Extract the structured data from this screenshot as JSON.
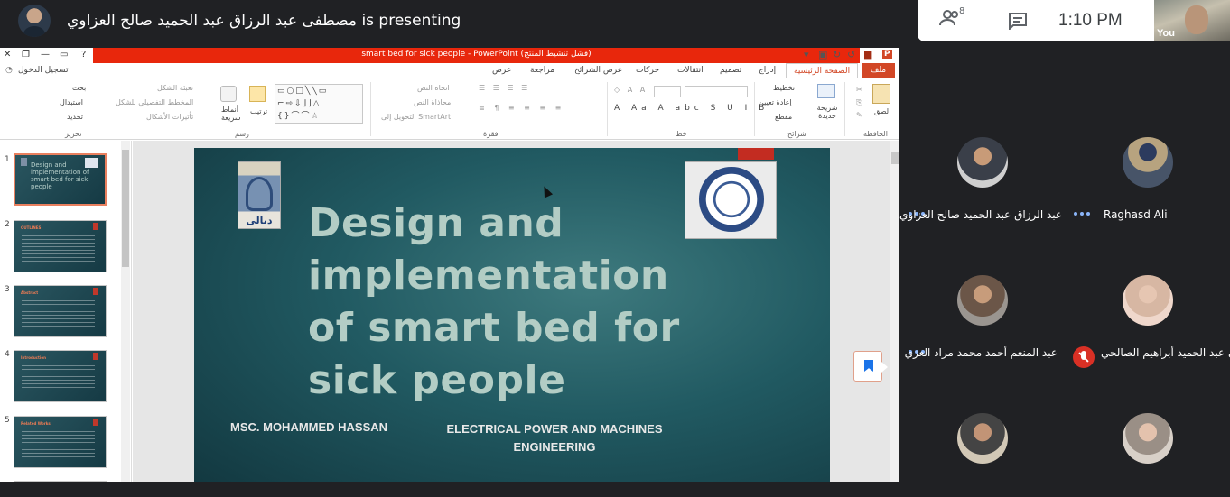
{
  "meet": {
    "presenter_text": "مصطفى عبد الرزاق عبد الحميد صالح العزاوي is presenting",
    "participant_count": "8",
    "time": "1:10 PM",
    "self_label": "You"
  },
  "ppt": {
    "window_title": "smart bed for sick people  -  PowerPoint  (فشل تنشيط المنتج)",
    "sign_in": "تسجيل الدخول",
    "tabs": {
      "file": "ملف",
      "home": "الصفحة الرئيسية",
      "insert": "إدراج",
      "design": "تصميم",
      "transitions": "انتقالات",
      "animations": "حركات",
      "slideshow": "عرض الشرائح",
      "review": "مراجعة",
      "view": "عرض"
    },
    "ribbon": {
      "paste": "لصق",
      "new_slide": "شريحة جديدة",
      "layout": "تخطيط",
      "reset": "إعادة تعيين",
      "section": "مقطع",
      "text_direction": "اتجاه النص",
      "align_text": "محاذاة النص",
      "convert_smartart": "التحويل إلى SmartArt",
      "arrange": "ترتيب",
      "quick_styles": "أنماط سريعة",
      "shape_fill": "تعبئة الشكل",
      "shape_outline": "المخطط التفصيلي للشكل",
      "shape_effects": "تأثيرات الأشكال",
      "find": "بحث",
      "replace": "استبدال",
      "select": "تحديد",
      "grp_clipboard": "الحافظة",
      "grp_slides": "شرائح",
      "grp_font": "خط",
      "grp_paragraph": "فقرة",
      "grp_drawing": "رسم",
      "grp_editing": "تحرير"
    },
    "thumbnails": [
      "1",
      "2",
      "3",
      "4",
      "5"
    ],
    "thumb_headings": [
      "OUTLINES",
      "Abstract",
      "Introduction",
      "Related Works"
    ],
    "thumb1_title": "Design and implementation of smart bed for sick people",
    "slide": {
      "title": "Design and implementation of smart bed for sick people",
      "author": "MSC. MOHAMMED HASSAN",
      "dept": "ELECTRICAL POWER AND MACHINES ENGINEERING",
      "logo_caption": "ديالى"
    }
  },
  "participants": [
    {
      "name": "مصطفى عبد الرزاق عبد الحميد صالح العزاوي",
      "muted": false
    },
    {
      "name": "Raghasd Ali",
      "muted": false
    },
    {
      "name": "عبد المنعم أحمد محمد مراد العزي",
      "muted": false
    },
    {
      "name": "بشرى عبد الحميد أبراهيم الصالحي",
      "muted": true
    },
    {
      "name": "",
      "muted": false
    },
    {
      "name": "",
      "muted": false
    }
  ],
  "colors": {
    "meet_bg": "#202124",
    "ppt_accent": "#d24726",
    "slide_bg": "#215a62",
    "title_text": "#b3cdc5"
  }
}
